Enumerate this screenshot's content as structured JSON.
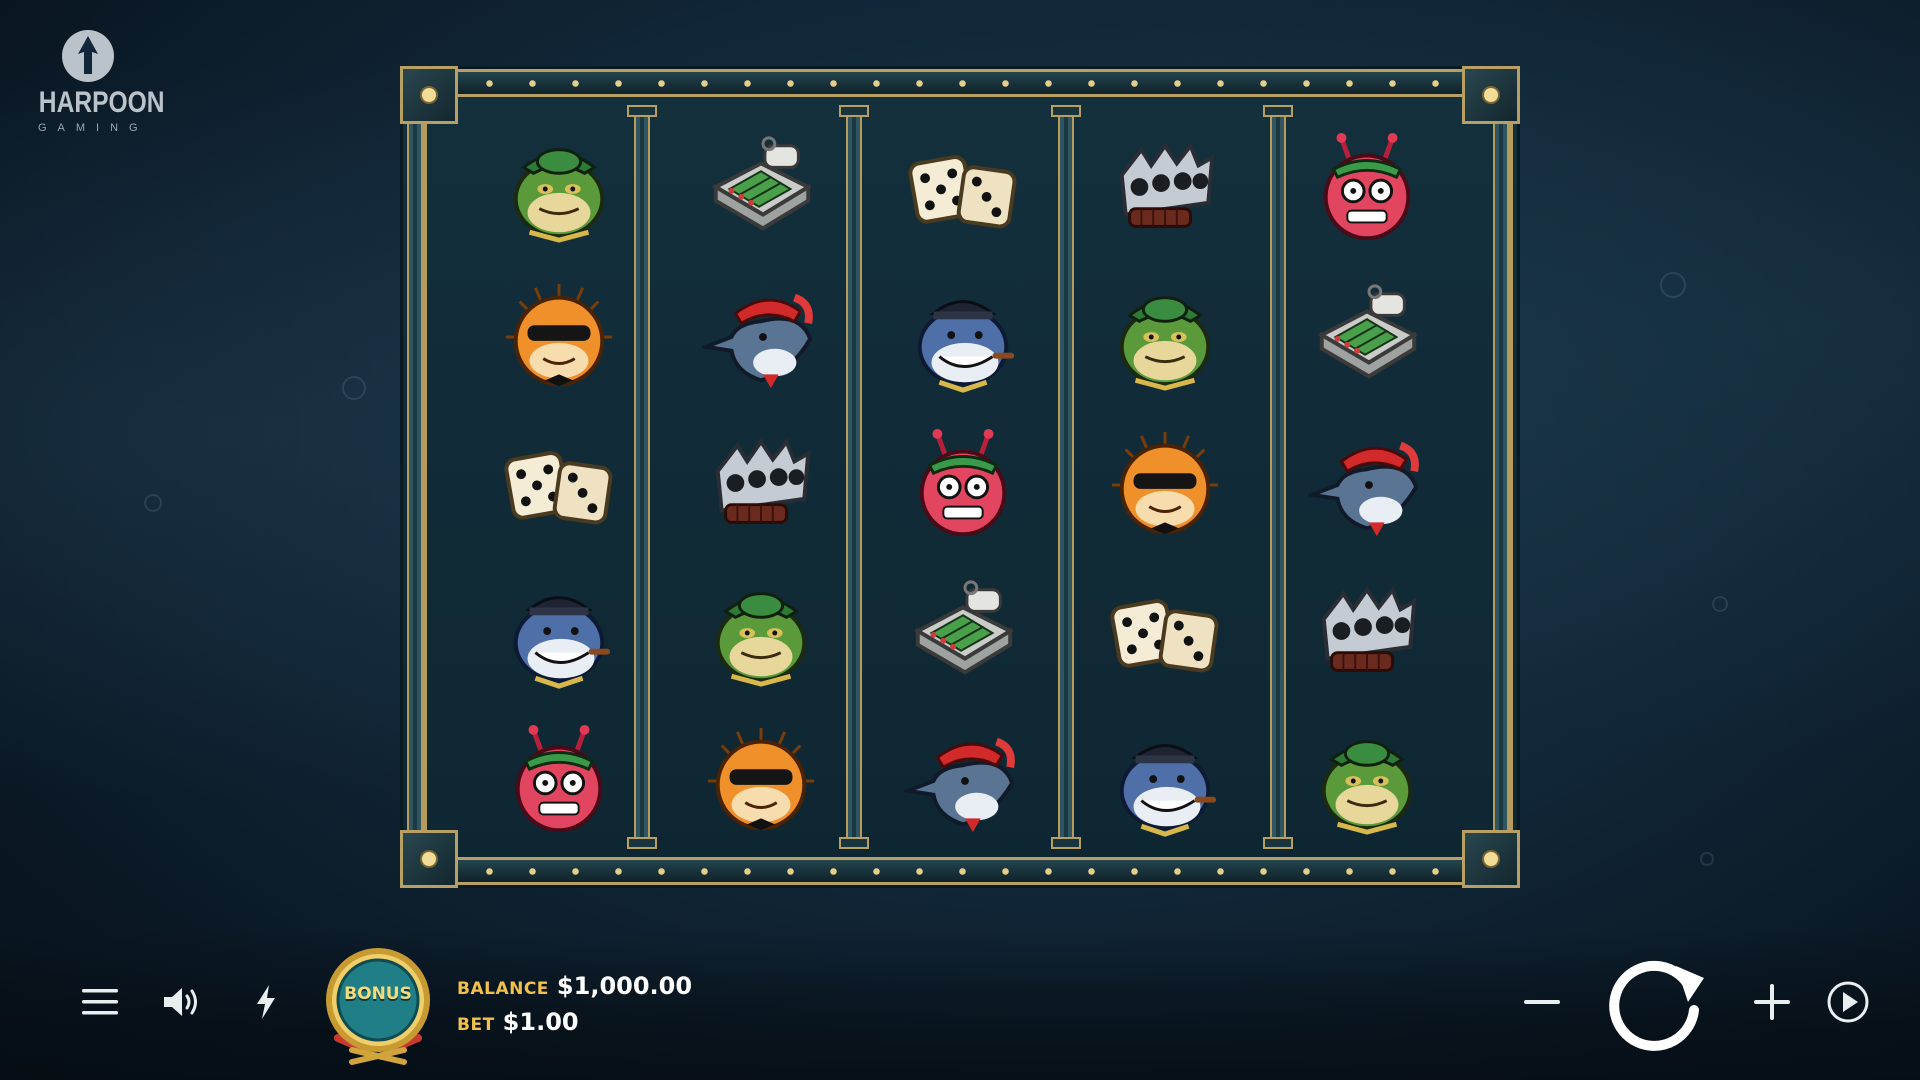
{
  "brand": {
    "title": "HARPOON",
    "subtitle": "GAMING"
  },
  "reels": [
    [
      "frog",
      "puffer",
      "dice",
      "shark",
      "crab"
    ],
    [
      "sardines",
      "swordfish",
      "knuckles",
      "frog",
      "puffer"
    ],
    [
      "dice",
      "shark",
      "crab",
      "sardines",
      "swordfish"
    ],
    [
      "knuckles",
      "frog",
      "puffer",
      "dice",
      "shark"
    ],
    [
      "crab",
      "sardines",
      "swordfish",
      "knuckles",
      "frog"
    ]
  ],
  "controls": {
    "bonus_label": "BONUS",
    "balance_label": "BALANCE",
    "balance_value": "$1,000.00",
    "bet_label": "BET",
    "bet_value": "$1.00"
  },
  "colors": {
    "accent_gold": "#f2c14a",
    "frame_gold": "#b8a065",
    "bonus_teal": "#1f7e86"
  }
}
